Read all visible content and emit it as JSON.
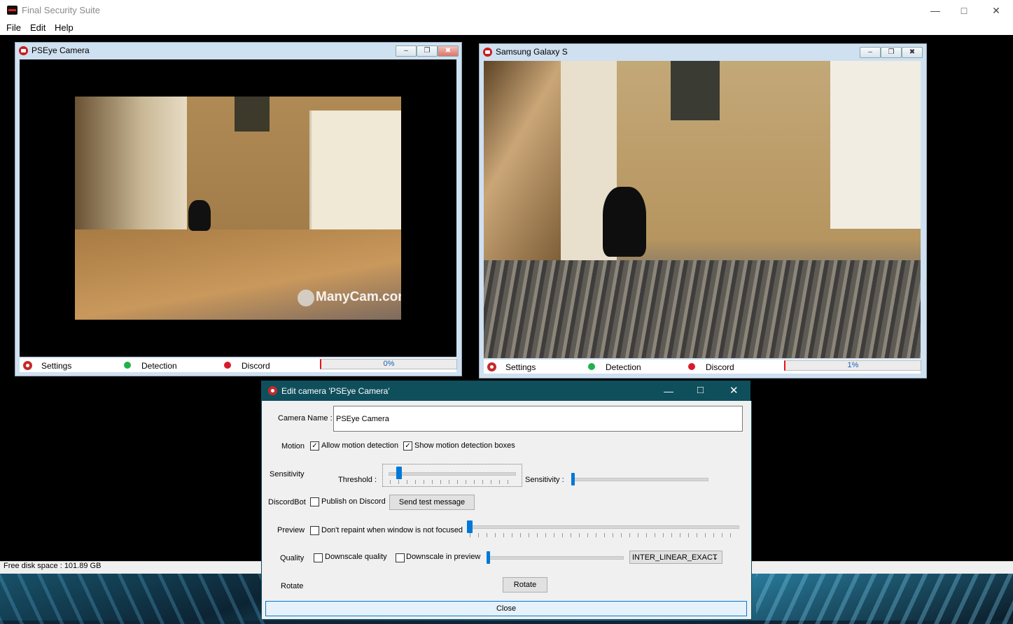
{
  "app": {
    "title": "Final Security Suite",
    "menu": [
      "File",
      "Edit",
      "Help"
    ],
    "disk_space": "Free disk space : 101.89 GB",
    "icon": "app-logo-icon"
  },
  "cameras": [
    {
      "title": "PSEye Camera",
      "watermark": "ManyCam.com",
      "settings_label": "Settings",
      "detection_label": "Detection",
      "discord_label": "Discord",
      "progress_text": "0%",
      "progress": 0
    },
    {
      "title": "Samsung Galaxy S",
      "settings_label": "Settings",
      "detection_label": "Detection",
      "discord_label": "Discord",
      "progress_text": "1%",
      "progress": 0.01
    }
  ],
  "status_colors": {
    "detection": "#22b14c",
    "discord": "#d81b2c",
    "accent": "#0078d7",
    "dialog_title": "#0f4f5c"
  },
  "dialog": {
    "title": "Edit camera 'PSEye Camera'",
    "camera_name_label": "Camera Name :",
    "camera_name_value": "PSEye Camera",
    "motion_label": "Motion",
    "allow_motion": {
      "label": "Allow motion detection",
      "checked": true
    },
    "show_boxes": {
      "label": "Show motion detection boxes",
      "checked": true
    },
    "sensitivity_label": "Sensitivity",
    "threshold_label": "Threshold :",
    "sensitivity_slider_label": "Sensitivity :",
    "discordbot_label": "DiscordBot",
    "publish_discord": {
      "label": "Publish on Discord",
      "checked": false
    },
    "send_test_label": "Send test message",
    "preview_label": "Preview",
    "dont_repaint": {
      "label": "Don't repaint when window is not focused",
      "checked": false
    },
    "quality_label": "Quality",
    "downscale_quality": {
      "label": "Downscale quality",
      "checked": false
    },
    "downscale_preview": {
      "label": "Downscale in preview",
      "checked": false
    },
    "interpolation_value": "INTER_LINEAR_EXACT",
    "rotate_label": "Rotate",
    "rotate_button": "Rotate",
    "close_button": "Close",
    "threshold_level": 0.05,
    "sensitivity_level": 0.0,
    "preview_level": 0.0,
    "quality_level": 0.0
  }
}
